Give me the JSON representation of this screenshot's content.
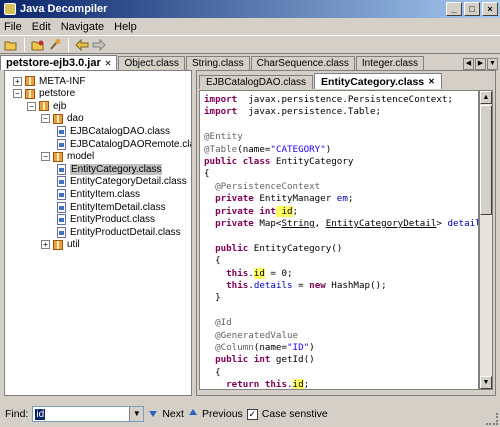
{
  "window": {
    "title": "Java Decompiler",
    "minimize": "_",
    "maximize": "□",
    "close": "×"
  },
  "menu": {
    "items": [
      "File",
      "Edit",
      "Navigate",
      "Help"
    ]
  },
  "toolbar": {
    "icons": [
      "open-folder-icon",
      "open-type-icon",
      "search-icon",
      "back-arrow-icon",
      "forward-arrow-icon"
    ]
  },
  "file_tabs": [
    {
      "label": "petstore-ejb3.0.jar",
      "active": true
    },
    {
      "label": "Object.class"
    },
    {
      "label": "String.class"
    },
    {
      "label": "CharSequence.class"
    },
    {
      "label": "Integer.class"
    }
  ],
  "tree": [
    {
      "label": "META-INF",
      "exp": "+",
      "icon": "pkg"
    },
    {
      "label": "petstore",
      "exp": "−",
      "icon": "pkg"
    },
    {
      "label": "ejb",
      "exp": "−",
      "icon": "pkg"
    },
    {
      "label": "dao",
      "exp": "−",
      "icon": "pkg"
    },
    {
      "label": "EJBCatalogDAO.class",
      "exp": "",
      "icon": "cls"
    },
    {
      "label": "EJBCatalogDAORemote.class",
      "exp": "",
      "icon": "cls"
    },
    {
      "label": "model",
      "exp": "−",
      "icon": "pkg"
    },
    {
      "label": "EntityCategory.class",
      "exp": "",
      "icon": "cls",
      "selected": true
    },
    {
      "label": "EntityCategoryDetail.class",
      "exp": "",
      "icon": "cls"
    },
    {
      "label": "EntityItem.class",
      "exp": "",
      "icon": "cls"
    },
    {
      "label": "EntityItemDetail.class",
      "exp": "",
      "icon": "cls"
    },
    {
      "label": "EntityProduct.class",
      "exp": "",
      "icon": "cls"
    },
    {
      "label": "EntityProductDetail.class",
      "exp": "",
      "icon": "cls"
    },
    {
      "label": "util",
      "exp": "+",
      "icon": "pkg"
    }
  ],
  "content_tabs": [
    {
      "label": "EJBCatalogDAO.class"
    },
    {
      "label": "EntityCategory.class",
      "active": true
    }
  ],
  "code": [
    [
      [
        "kw",
        "import"
      ],
      [
        "",
        "  javax.persistence.PersistenceContext;"
      ]
    ],
    [
      [
        "kw",
        "import"
      ],
      [
        "",
        "  javax.persistence.Table;"
      ]
    ],
    [],
    [
      [
        "ann",
        "@Entity"
      ]
    ],
    [
      [
        "ann",
        "@Table"
      ],
      [
        "",
        "(name="
      ],
      [
        "str",
        "\"CATEGORY\""
      ],
      [
        "",
        ")"
      ]
    ],
    [
      [
        "kw",
        "public class"
      ],
      [
        "",
        " EntityCategory"
      ]
    ],
    [
      [
        "",
        "{"
      ]
    ],
    [
      [
        "ann",
        "  @PersistenceContext"
      ]
    ],
    [
      [
        "kw",
        "  private"
      ],
      [
        "",
        " EntityManager "
      ],
      [
        "fld",
        "em"
      ],
      [
        "",
        ";"
      ]
    ],
    [
      [
        "kw",
        "  private int"
      ],
      [
        "",
        ""
      ],
      [
        "hl",
        " id"
      ],
      [
        "",
        ";"
      ]
    ],
    [
      [
        "kw",
        "  private"
      ],
      [
        "",
        " Map<"
      ],
      [
        "ul",
        "String"
      ],
      [
        "",
        ", "
      ],
      [
        "ul",
        "EntityCategoryDetail"
      ],
      [
        "",
        "> "
      ],
      [
        "fld",
        "details"
      ],
      [
        "",
        ";"
      ]
    ],
    [],
    [
      [
        "kw",
        "  public"
      ],
      [
        "",
        " EntityCategory()"
      ]
    ],
    [
      [
        "",
        "  {"
      ]
    ],
    [
      [
        "kw",
        "    this"
      ],
      [
        "",
        "."
      ],
      [
        "hl",
        "id"
      ],
      [
        "",
        " = 0;"
      ]
    ],
    [
      [
        "kw",
        "    this"
      ],
      [
        "",
        "."
      ],
      [
        "fld",
        "details"
      ],
      [
        "",
        " = "
      ],
      [
        "kw",
        "new"
      ],
      [
        "",
        " HashMap();"
      ]
    ],
    [
      [
        "",
        "  }"
      ]
    ],
    [],
    [
      [
        "ann",
        "  @Id"
      ]
    ],
    [
      [
        "ann",
        "  @GeneratedValue"
      ]
    ],
    [
      [
        "ann",
        "  @Column"
      ],
      [
        "",
        "(name="
      ],
      [
        "str",
        "\"ID\""
      ],
      [
        "",
        ")"
      ]
    ],
    [
      [
        "kw",
        "  public int"
      ],
      [
        "",
        " getId()"
      ]
    ],
    [
      [
        "",
        "  {"
      ]
    ],
    [
      [
        "kw",
        "    return this"
      ],
      [
        "",
        "."
      ],
      [
        "hl",
        "id"
      ],
      [
        "",
        ";"
      ]
    ]
  ],
  "findbar": {
    "label": "Find:",
    "value": "id",
    "next": "Next",
    "previous": "Previous",
    "case_sensitive": "Case senstive",
    "case_checked": true
  }
}
